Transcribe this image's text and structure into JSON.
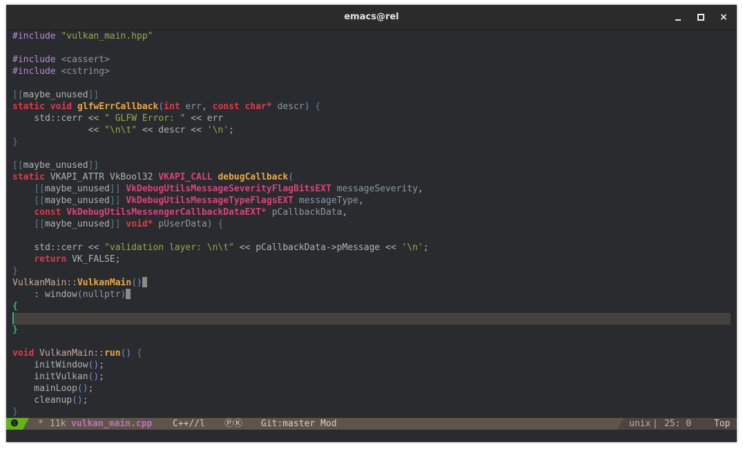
{
  "window": {
    "title": "emacs@rel",
    "minimize_label": "",
    "maximize_label": "",
    "close_label": "×"
  },
  "editor": {
    "lines": [
      "#include \"vulkan_main.hpp\"",
      "",
      "#include <cassert>",
      "#include <cstring>",
      "",
      "[[maybe_unused]]",
      "static void glfwErrCallback(int err, const char* descr) {",
      "    std::cerr << \" GLFW Error: \" << err",
      "              << \"\\n\\t\" << descr << '\\n';",
      "}",
      "",
      "[[maybe_unused]]",
      "static VKAPI_ATTR VkBool32 VKAPI_CALL debugCallback(",
      "    [[maybe_unused]] VkDebugUtilsMessageSeverityFlagBitsEXT messageSeverity,",
      "    [[maybe_unused]] VkDebugUtilsMessageTypeFlagsEXT messageType,",
      "    const VkDebugUtilsMessengerCallbackDataEXT* pCallbackData,",
      "    [[maybe_unused]] void* pUserData) {",
      "",
      "    std::cerr << \"validation layer: \\n\\t\" << pCallbackData->pMessage << '\\n';",
      "    return VK_FALSE;",
      "}",
      "VulkanMain::VulkanMain()",
      "    : window(nullptr)",
      "{",
      "",
      "}",
      "",
      "void VulkanMain::run() {",
      "    initWindow();",
      "    initVulkan();",
      "    mainLoop();",
      "    cleanup();",
      "}"
    ]
  },
  "modeline": {
    "window_number": "❶",
    "modified": "*",
    "size": "11k",
    "buffer_name": "vulkan_main.cpp",
    "major_mode": "C++//l",
    "minor_modes": "ⓅⓀ",
    "vcs": "Git:master Mod",
    "encoding": "unix",
    "position": "25: 0",
    "scroll": "Top"
  },
  "colors": {
    "background": "#292b2e",
    "keyword": "#dd3b4d",
    "preprocessor": "#b78ad8",
    "string": "#9da74e",
    "function": "#e8a94a",
    "type": "#d9447a",
    "cursor": "#2cbd6e",
    "modeline_bg": "#5e5449",
    "window_number_bg": "#67b11d"
  }
}
